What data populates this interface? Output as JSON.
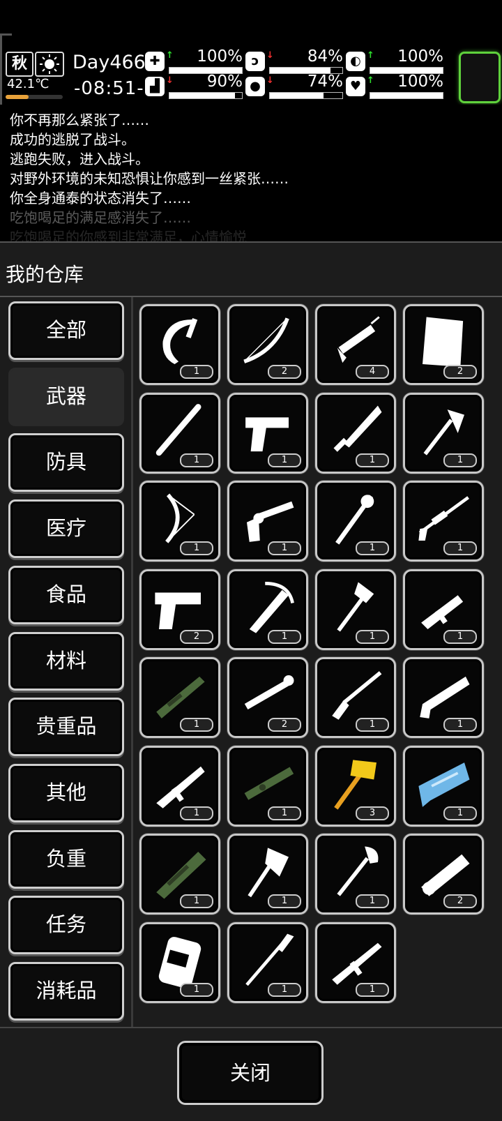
{
  "hud": {
    "season": "秋",
    "weather_icon": "sun-icon",
    "temperature": "42.1℃",
    "temperature_level": 0.4,
    "day": "Day466",
    "time": "-08:51-",
    "stats": [
      {
        "name": "health",
        "icon": "medkit-icon",
        "trend": "up",
        "value": "100%",
        "level": 1.0
      },
      {
        "name": "hunger",
        "icon": "stomach-icon",
        "trend": "down",
        "value": "84%",
        "level": 0.84
      },
      {
        "name": "mood",
        "icon": "pill-icon",
        "trend": "up",
        "value": "100%",
        "level": 1.0
      },
      {
        "name": "stamina",
        "icon": "boot-icon",
        "trend": "down",
        "value": "90%",
        "level": 0.9
      },
      {
        "name": "thirst",
        "icon": "water-drop-icon",
        "trend": "down",
        "value": "74%",
        "level": 0.74
      },
      {
        "name": "spirit",
        "icon": "heart-icon",
        "trend": "up",
        "value": "100%",
        "level": 1.0
      }
    ],
    "accent_color": "#5fd13c"
  },
  "log": [
    {
      "text": "你不再那么紧张了……",
      "opacity": 1
    },
    {
      "text": "成功的逃脱了战斗。",
      "opacity": 1
    },
    {
      "text": "逃跑失败，进入战斗。",
      "opacity": 1
    },
    {
      "text": "对野外环境的未知恐惧让你感到一丝紧张……",
      "opacity": 1
    },
    {
      "text": "你全身通泰的状态消失了……",
      "opacity": 1
    },
    {
      "text": "吃饱喝足的满足感消失了……",
      "opacity": 0.35
    },
    {
      "text": "吃饱喝足的你感到非常满足，心情愉悦",
      "opacity": 0.15
    }
  ],
  "panel": {
    "title": "我的仓库",
    "close_label": "关闭"
  },
  "categories": [
    {
      "label": "全部",
      "active": false
    },
    {
      "label": "武器",
      "active": true
    },
    {
      "label": "防具",
      "active": false
    },
    {
      "label": "医疗",
      "active": false
    },
    {
      "label": "食品",
      "active": false
    },
    {
      "label": "材料",
      "active": false
    },
    {
      "label": "贵重品",
      "active": false
    },
    {
      "label": "其他",
      "active": false
    },
    {
      "label": "负重",
      "active": false
    },
    {
      "label": "任务",
      "active": false
    },
    {
      "label": "消耗品",
      "active": false
    }
  ],
  "items": [
    {
      "icon": "sickle-icon",
      "qty": "1"
    },
    {
      "icon": "bow-icon",
      "qty": "2"
    },
    {
      "icon": "syringe-icon",
      "qty": "4"
    },
    {
      "icon": "paper-icon",
      "qty": "2"
    },
    {
      "icon": "baseball-bat-icon",
      "qty": "1"
    },
    {
      "icon": "desert-eagle-icon",
      "qty": "1"
    },
    {
      "icon": "machete-icon",
      "qty": "1"
    },
    {
      "icon": "axe-icon",
      "qty": "1"
    },
    {
      "icon": "compound-bow-icon",
      "qty": "1"
    },
    {
      "icon": "revolver-icon",
      "qty": "1"
    },
    {
      "icon": "spiked-club-icon",
      "qty": "1"
    },
    {
      "icon": "sniper-rifle-icon",
      "qty": "1"
    },
    {
      "icon": "pistol-icon",
      "qty": "2"
    },
    {
      "icon": "crossbow-icon",
      "qty": "1"
    },
    {
      "icon": "hammer-axe-icon",
      "qty": "1"
    },
    {
      "icon": "submachine-gun-icon",
      "qty": "1"
    },
    {
      "icon": "camo-rifle-icon",
      "qty": "1"
    },
    {
      "icon": "rocket-launcher-icon",
      "qty": "2"
    },
    {
      "icon": "shotgun-icon",
      "qty": "1"
    },
    {
      "icon": "pump-shotgun-icon",
      "qty": "1"
    },
    {
      "icon": "assault-rifle-icon",
      "qty": "1"
    },
    {
      "icon": "camo-rpg-icon",
      "qty": "1"
    },
    {
      "icon": "golden-hammer-icon",
      "qty": "3"
    },
    {
      "icon": "ice-blaster-icon",
      "qty": "1"
    },
    {
      "icon": "camo-minigun-icon",
      "qty": "1"
    },
    {
      "icon": "hatchet-icon",
      "qty": "1"
    },
    {
      "icon": "shovel-icon",
      "qty": "1"
    },
    {
      "icon": "minigun-icon",
      "qty": "2"
    },
    {
      "icon": "backpack-icon",
      "qty": "1"
    },
    {
      "icon": "spear-icon",
      "qty": "1"
    },
    {
      "icon": "m16-rifle-icon",
      "qty": "1"
    }
  ]
}
